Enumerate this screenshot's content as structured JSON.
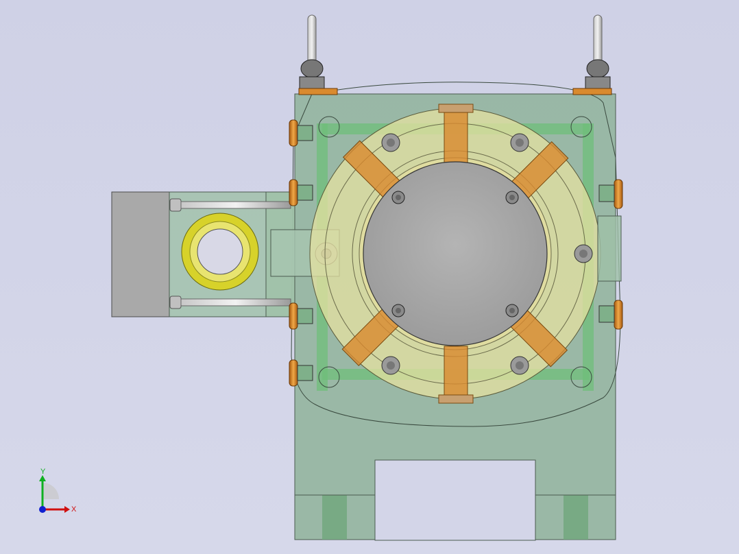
{
  "viewport": {
    "background_color": "#d0d2e6",
    "view_orientation": "front"
  },
  "model": {
    "body_color": "#8fb39a",
    "flange_color": "#e6e2a0",
    "center_disc_color": "#a9a9a9",
    "fitting_color": "#d98a2e",
    "seat_ring_color": "#d7d22a",
    "side_block_color": "#a9a9a9"
  },
  "triad": {
    "x_label": "X",
    "y_label": "Y",
    "x_color": "#d01010",
    "y_color": "#10b020",
    "z_color": "#1020d0"
  }
}
